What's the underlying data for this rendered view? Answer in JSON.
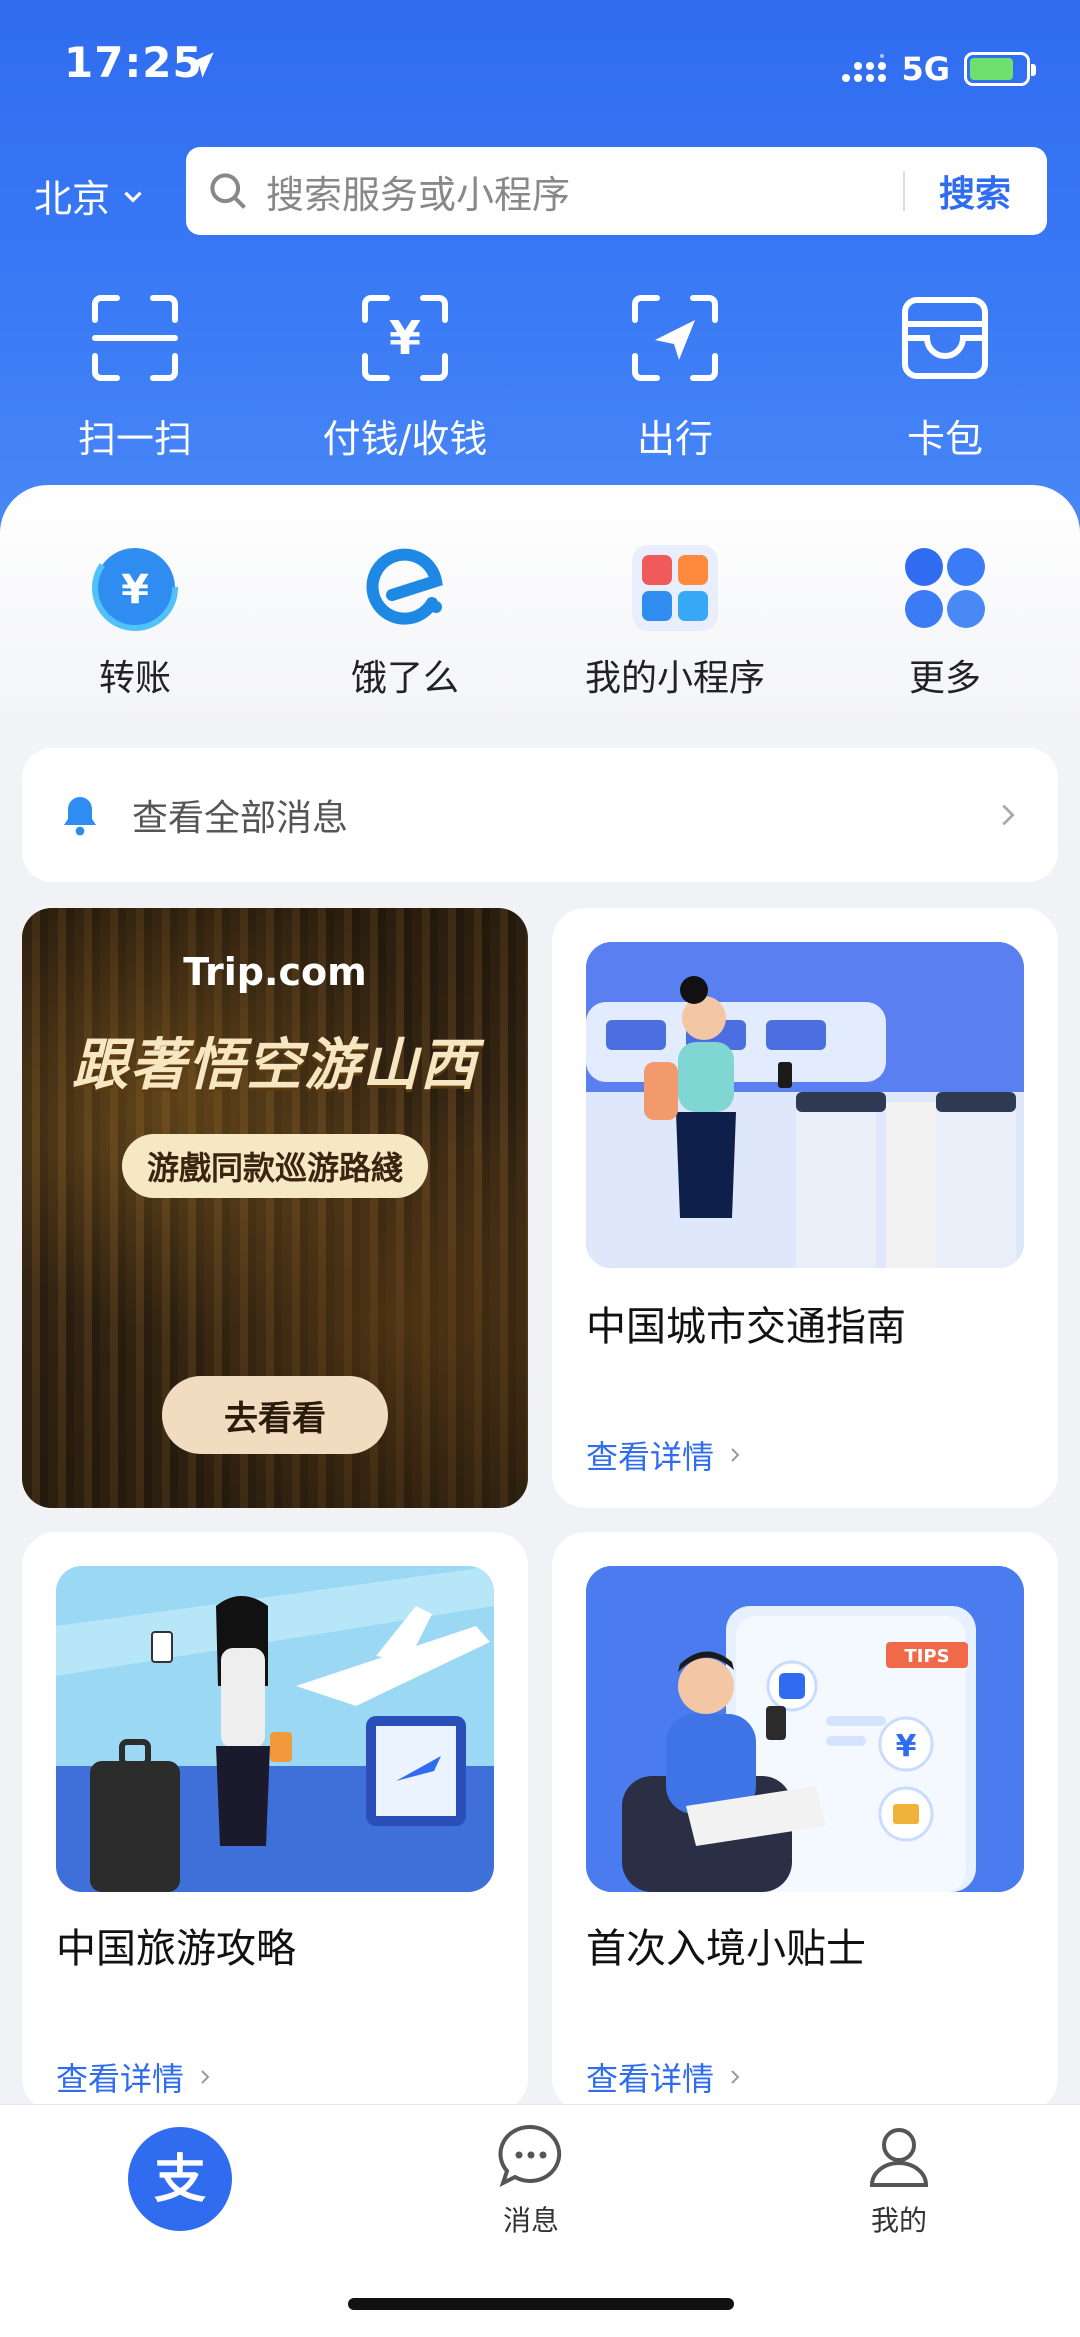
{
  "status_bar": {
    "time": "17:25",
    "network": "5G"
  },
  "header": {
    "city": "北京",
    "search_placeholder": "搜索服务或小程序",
    "search_button": "搜索"
  },
  "top_actions": [
    {
      "label": "扫一扫",
      "icon": "scan-icon"
    },
    {
      "label": "付钱/收钱",
      "icon": "pay-receive-icon"
    },
    {
      "label": "出行",
      "icon": "travel-icon"
    },
    {
      "label": "卡包",
      "icon": "card-wallet-icon"
    }
  ],
  "mini_actions": [
    {
      "label": "转账",
      "icon": "transfer-icon"
    },
    {
      "label": "饿了么",
      "icon": "eleme-icon"
    },
    {
      "label": "我的小程序",
      "icon": "mini-programs-icon"
    },
    {
      "label": "更多",
      "icon": "more-icon"
    }
  ],
  "notice": {
    "text": "查看全部消息"
  },
  "promo": {
    "brand": "Trip.com",
    "headline": "跟著悟空游山西",
    "subtitle": "游戲同款巡游路綫",
    "button": "去看看"
  },
  "cards": [
    {
      "title": "中国城市交通指南",
      "link": "查看详情"
    },
    {
      "title": "中国旅游攻略",
      "link": "查看详情"
    },
    {
      "title": "首次入境小贴士",
      "link": "查看详情",
      "badge": "TIPS"
    }
  ],
  "tab_bar": {
    "home_glyph": "支",
    "messages": "消息",
    "mine": "我的"
  },
  "colors": {
    "brand_blue": "#2f6cf0",
    "green_battery": "#6ee06e"
  }
}
